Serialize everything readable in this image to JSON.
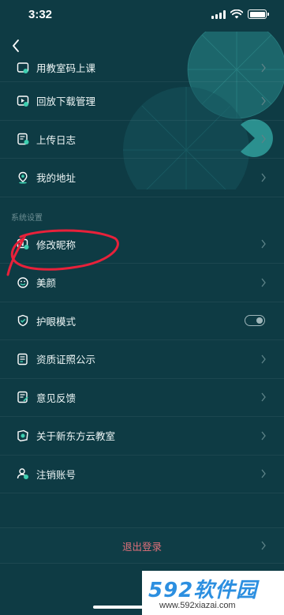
{
  "status_bar": {
    "time": "3:32"
  },
  "menu_top": [
    {
      "id": "classroom-code",
      "label": "用教室码上课",
      "icon": "classroom-code-icon"
    },
    {
      "id": "download-manage",
      "label": "回放下载管理",
      "icon": "download-manage-icon"
    },
    {
      "id": "upload-log",
      "label": "上传日志",
      "icon": "upload-log-icon"
    },
    {
      "id": "my-address",
      "label": "我的地址",
      "icon": "location-pin-icon"
    }
  ],
  "section": {
    "title": "系统设置"
  },
  "menu_settings": [
    {
      "id": "edit-nickname",
      "label": "修改昵称",
      "icon": "edit-nickname-icon"
    },
    {
      "id": "beauty",
      "label": "美颜",
      "icon": "beauty-face-icon"
    },
    {
      "id": "eye-protect",
      "label": "护眼模式",
      "icon": "shield-check-icon",
      "toggle": false
    },
    {
      "id": "qualification",
      "label": "资质证照公示",
      "icon": "certificate-icon"
    },
    {
      "id": "feedback",
      "label": "意见反馈",
      "icon": "feedback-icon"
    },
    {
      "id": "about",
      "label": "关于新东方云教室",
      "icon": "about-app-icon"
    },
    {
      "id": "cancel-account",
      "label": "注销账号",
      "icon": "cancel-account-icon"
    }
  ],
  "logout": {
    "label": "退出登录"
  },
  "watermark": {
    "logo_num": "592",
    "logo_text": "软件园",
    "url": "www.592xiazai.com"
  },
  "colors": {
    "background": "#0e3b44",
    "accent": "#3ecfb0",
    "logout": "#e0707a",
    "annotation": "#e8213a"
  }
}
